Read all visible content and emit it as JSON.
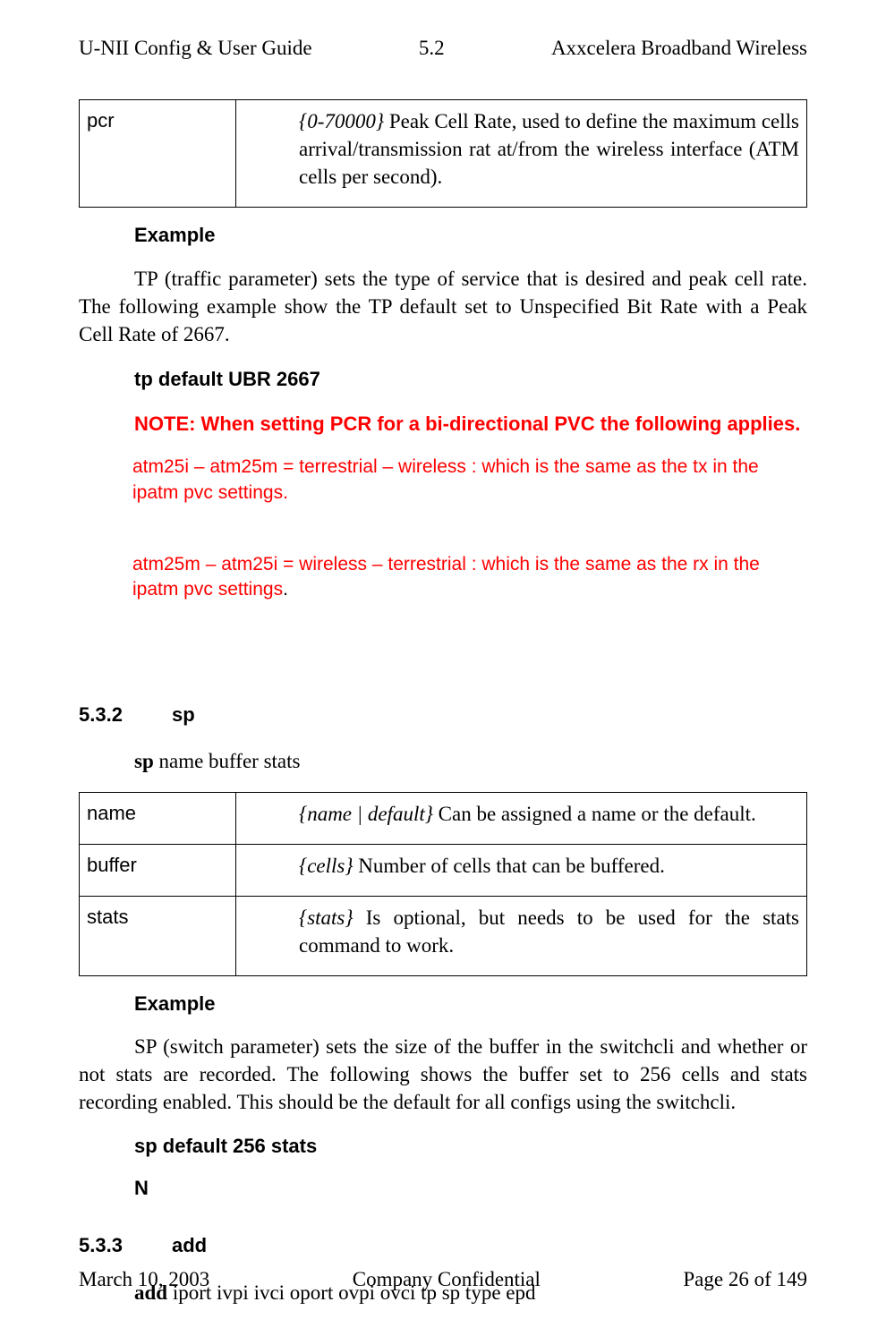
{
  "header": {
    "left": "U-NII Config & User Guide",
    "center": "5.2",
    "right": "Axxcelera Broadband Wireless"
  },
  "pcr_table": {
    "label": "pcr",
    "range": "{0-70000}",
    "desc_rest": " Peak Cell Rate, used to define the maximum cells arrival/transmission rat at/from the wireless interface (ATM cells per second)."
  },
  "example1": {
    "heading": "Example",
    "para": "TP (traffic parameter) sets the type of service that is desired and peak cell rate. The following example show the TP default set to Unspecified Bit Rate with a Peak Cell Rate of 2667.",
    "cmd": "tp   default   UBR   2667",
    "note_heading": "NOTE: When setting PCR for a bi-directional PVC the following applies.",
    "note_line1": "atm25i – atm25m  = terrestrial – wireless : which is the same as the tx in the ipatm pvc settings.",
    "note_line2": "atm25m – atm25i  = wireless – terrestrial : which is the same as the rx in the ipatm pvc settings",
    "note_line2_dot": "."
  },
  "section_sp": {
    "num": "5.3.2",
    "title": "sp",
    "syntax_cmd": "sp",
    "syntax_args": "   name   buffer   stats",
    "rows": {
      "name": {
        "label": "name",
        "italic": "{name | default}",
        "rest": " Can be assigned a name or the default."
      },
      "buffer": {
        "label": "buffer",
        "italic": "{cells}",
        "rest": " Number of cells that can be buffered."
      },
      "stats": {
        "label": "stats",
        "italic": "{stats}",
        "rest": " Is optional, but needs to be used for the stats command to work."
      }
    },
    "example_heading": "Example",
    "example_para": "SP (switch parameter) sets the size of the buffer in the switchcli and whether or not stats are recorded. The following shows the buffer set to 256 cells and stats recording enabled. This should be the default for all configs using the switchcli.",
    "example_cmd": "sp   default   256 stats",
    "example_n": "N"
  },
  "section_add": {
    "num": "5.3.3",
    "title": "add",
    "syntax_cmd": "add",
    "syntax_args": "   iport  ivpi   ivci   oport   ovpi   ovci   tp   sp   type epd"
  },
  "footer": {
    "left": "March 10, 2003",
    "center": "Company Confidential",
    "right": "Page 26 of 149"
  }
}
